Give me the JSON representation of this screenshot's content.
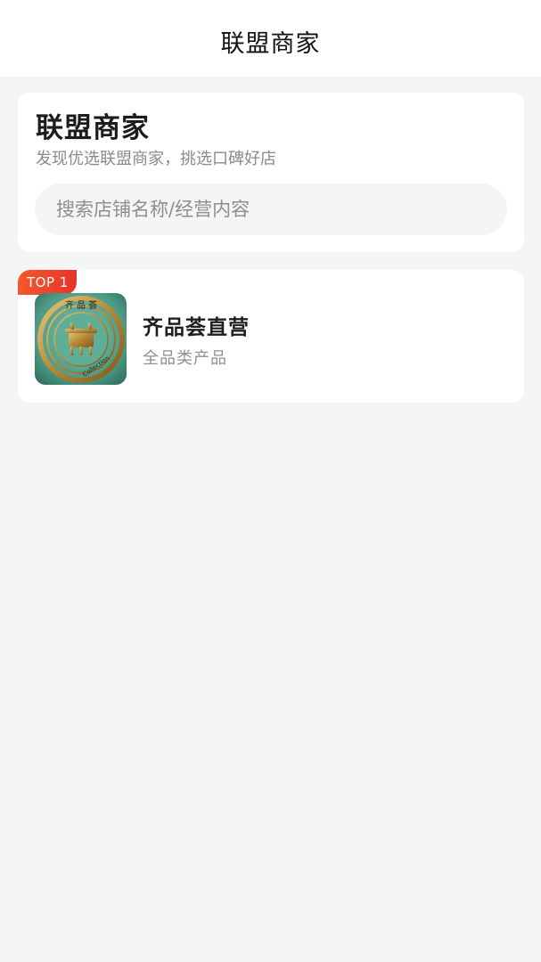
{
  "nav": {
    "title": "联盟商家"
  },
  "header": {
    "title": "联盟商家",
    "subtitle": "发现优选联盟商家，挑选口碑好店"
  },
  "search": {
    "placeholder": "搜索店铺名称/经营内容",
    "value": ""
  },
  "stores": [
    {
      "rank_label": "TOP 1",
      "name": "齐品荟直营",
      "category": "全品类产品",
      "logo_text": "齐 品 荟",
      "logo_caption": "Collection",
      "logo_colors": {
        "background": "#4e9a86",
        "gold": "#c9a24c"
      }
    }
  ],
  "colors": {
    "page_background": "#f4f5f7",
    "card_background": "#ffffff",
    "badge_start": "#f2592d",
    "badge_end": "#e8332a"
  }
}
